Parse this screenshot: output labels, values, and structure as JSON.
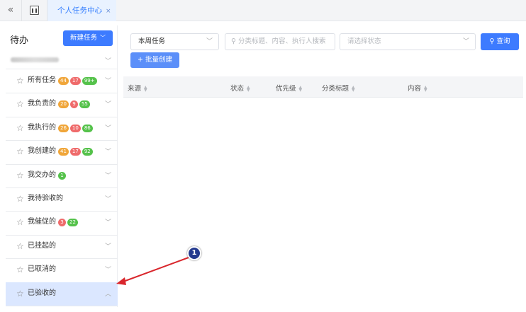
{
  "topbar": {
    "collapse_glyph": "«",
    "home_icon": "dashboard-icon",
    "active_tab": "个人任务中心",
    "close_glyph": "×"
  },
  "left": {
    "title": "待办",
    "new_button": "新建任务",
    "items": [
      {
        "label": "所有任务",
        "badges": [
          {
            "text": "44",
            "color": "orange"
          },
          {
            "text": "17",
            "color": "red"
          },
          {
            "text": "99+",
            "color": "green"
          }
        ]
      },
      {
        "label": "我负责的",
        "badges": [
          {
            "text": "20",
            "color": "orange"
          },
          {
            "text": "9",
            "color": "red"
          },
          {
            "text": "55",
            "color": "green"
          }
        ]
      },
      {
        "label": "我执行的",
        "badges": [
          {
            "text": "26",
            "color": "orange"
          },
          {
            "text": "10",
            "color": "red"
          },
          {
            "text": "86",
            "color": "green"
          }
        ]
      },
      {
        "label": "我创建的",
        "badges": [
          {
            "text": "41",
            "color": "orange"
          },
          {
            "text": "17",
            "color": "red"
          },
          {
            "text": "92",
            "color": "green"
          }
        ]
      },
      {
        "label": "我交办的",
        "badges": [
          {
            "text": "1",
            "color": "green"
          }
        ]
      },
      {
        "label": "我待验收的",
        "badges": []
      },
      {
        "label": "我催促的",
        "badges": [
          {
            "text": "3",
            "color": "red"
          },
          {
            "text": "22",
            "color": "green"
          }
        ]
      },
      {
        "label": "已挂起的",
        "badges": []
      },
      {
        "label": "已取消的",
        "badges": []
      },
      {
        "label": "已验收的",
        "badges": [],
        "active": true
      }
    ]
  },
  "filters": {
    "period": "本周任务",
    "search_placeholder": "分类标题、内容、执行人搜索",
    "status_placeholder": "请选择状态",
    "search_button": "查询",
    "batch_button": "+ 批量创建"
  },
  "table": {
    "columns": [
      "来源",
      "状态",
      "优先级",
      "分类标题",
      "内容"
    ]
  },
  "annotation": {
    "step": "1"
  },
  "colors": {
    "primary": "#3d7bff",
    "badge_orange": "#f0a63a",
    "badge_red": "#ef6b6b",
    "badge_green": "#55c24b",
    "active_item": "#dbe7ff",
    "arrow": "#d9262c"
  }
}
